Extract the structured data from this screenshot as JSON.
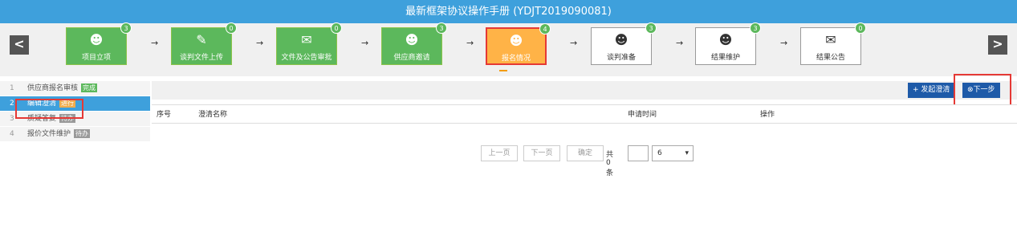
{
  "title": "最新框架协议操作手册 (YDJT2019090081)",
  "nav": {
    "prev": "<",
    "next": ">"
  },
  "steps": [
    {
      "label": "项目立项",
      "count": "3",
      "state": "done",
      "icon": "person-icon"
    },
    {
      "label": "谈判文件上传",
      "count": "0",
      "state": "done",
      "icon": "pencil-icon"
    },
    {
      "label": "文件及公告审批",
      "count": "0",
      "state": "done",
      "icon": "stamp-icon"
    },
    {
      "label": "供应商邀请",
      "count": "3",
      "state": "done",
      "icon": "person-icon"
    },
    {
      "label": "报名情况",
      "count": "4",
      "state": "current",
      "icon": "person-icon"
    },
    {
      "label": "谈判准备",
      "count": "3",
      "state": "pending",
      "icon": "person-icon"
    },
    {
      "label": "结果维护",
      "count": "3",
      "state": "pending",
      "icon": "person-icon"
    },
    {
      "label": "结果公告",
      "count": "0",
      "state": "pending",
      "icon": "envelope-icon"
    }
  ],
  "sidebar": [
    {
      "num": "1",
      "label": "供应商报名审核",
      "status": "完成"
    },
    {
      "num": "2",
      "label": "编辑澄清",
      "status": "进行"
    },
    {
      "num": "3",
      "label": "质疑答复",
      "status": "待办"
    },
    {
      "num": "4",
      "label": "报价文件维护",
      "status": "待办"
    }
  ],
  "toolbar": {
    "start_clarify": "发起澄清",
    "next_step": "下一步"
  },
  "table": {
    "headers": [
      "序号",
      "澄清名称",
      "申请时间",
      "操作"
    ]
  },
  "pager": {
    "prev": "上一页",
    "next": "下一页",
    "confirm": "确定",
    "total": "共0条",
    "page_size": "6"
  },
  "colors": {
    "titlebar": "#3ea0dc",
    "done": "#5cb85c",
    "current": "#ffb347",
    "primary": "#1e5aa8"
  }
}
